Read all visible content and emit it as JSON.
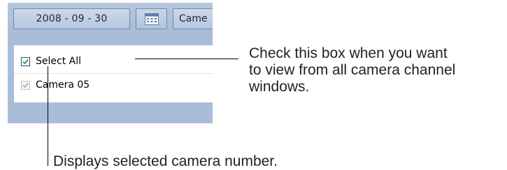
{
  "toolbar": {
    "date_value": "2008 - 09 - 30",
    "calendar_icon": "calendar-icon",
    "camera_select_value": "Came"
  },
  "camera_list": {
    "items": [
      {
        "label": "Select All",
        "checked": true,
        "enabled": true
      },
      {
        "label": "Camera 05",
        "checked": true,
        "enabled": false
      }
    ]
  },
  "annotations": {
    "select_all_lines": [
      "Check this box when you want",
      "to view from all camera channel",
      "windows."
    ],
    "camera_number": "Displays selected camera number."
  },
  "colors": {
    "panel_background": "#a9bdd8",
    "checkbox_check": "#2e9e2e",
    "checkbox_disabled": "#a9a9a4",
    "annotation_text": "#222222"
  }
}
